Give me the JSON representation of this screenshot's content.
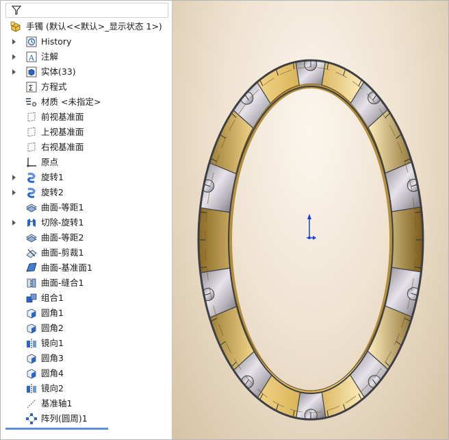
{
  "tree": {
    "root_label": "手镯  (默认<<默认>_显示状态 1>)",
    "items": [
      {
        "label": "History",
        "icon": "history-icon",
        "expandable": true
      },
      {
        "label": "注解",
        "icon": "annotation-icon",
        "expandable": true
      },
      {
        "label": "实体(33)",
        "icon": "solid-bodies-icon",
        "expandable": true
      },
      {
        "label": "方程式",
        "icon": "equations-icon",
        "expandable": false
      },
      {
        "label": "材质 <未指定>",
        "icon": "material-icon",
        "expandable": false
      },
      {
        "label": "前视基准面",
        "icon": "plane-icon",
        "expandable": false
      },
      {
        "label": "上视基准面",
        "icon": "plane-icon",
        "expandable": false
      },
      {
        "label": "右视基准面",
        "icon": "plane-icon",
        "expandable": false
      },
      {
        "label": "原点",
        "icon": "origin-icon",
        "expandable": false
      },
      {
        "label": "旋转1",
        "icon": "revolve-icon",
        "expandable": true
      },
      {
        "label": "旋转2",
        "icon": "revolve-icon",
        "expandable": true
      },
      {
        "label": "曲面-等距1",
        "icon": "offset-surface-icon",
        "expandable": false
      },
      {
        "label": "切除-旋转1",
        "icon": "revolve-cut-icon",
        "expandable": true
      },
      {
        "label": "曲面-等距2",
        "icon": "offset-surface-icon",
        "expandable": false
      },
      {
        "label": "曲面-剪裁1",
        "icon": "trim-surface-icon",
        "expandable": false
      },
      {
        "label": "曲面-基准面1",
        "icon": "planar-surface-icon",
        "expandable": false
      },
      {
        "label": "曲面-缝合1",
        "icon": "knit-surface-icon",
        "expandable": false
      },
      {
        "label": "组合1",
        "icon": "combine-icon",
        "expandable": false
      },
      {
        "label": "圆角1",
        "icon": "fillet-icon",
        "expandable": false
      },
      {
        "label": "圆角2",
        "icon": "fillet-icon",
        "expandable": false
      },
      {
        "label": "镜向1",
        "icon": "mirror-icon",
        "expandable": false
      },
      {
        "label": "圆角3",
        "icon": "fillet-icon",
        "expandable": false
      },
      {
        "label": "圆角4",
        "icon": "fillet-icon",
        "expandable": false
      },
      {
        "label": "镜向2",
        "icon": "mirror-icon",
        "expandable": false
      },
      {
        "label": "基准轴1",
        "icon": "axis-icon",
        "expandable": false
      },
      {
        "label": "阵列(圆周)1",
        "icon": "circular-pattern-icon",
        "expandable": false
      }
    ]
  },
  "colors": {
    "gold": "#c9a24a",
    "silver": "#b9b6bd",
    "triad_blue": "#1a3fd6",
    "selection_line": "#5b8fd9"
  }
}
